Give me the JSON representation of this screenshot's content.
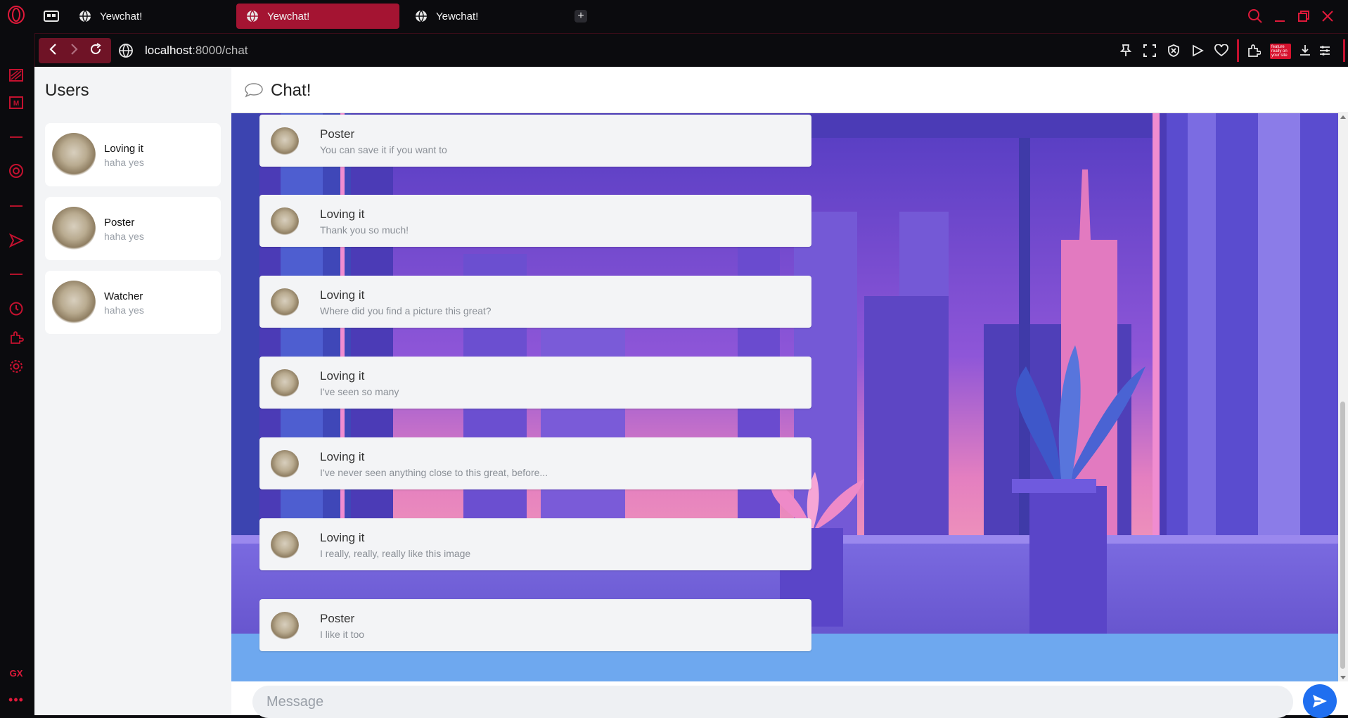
{
  "browser": {
    "tabs": [
      {
        "title": "Yewchat!",
        "active": false
      },
      {
        "title": "Yewchat!",
        "active": true
      },
      {
        "title": "Yewchat!",
        "active": false
      }
    ],
    "new_tab_label": "+",
    "url_host": "localhost",
    "url_path": ":8000/chat",
    "accent_color": "#e0193a",
    "sidebar_badge": "GX",
    "sidebar_more": "•••",
    "extension_thumb_text": "feature really on your site"
  },
  "users_panel": {
    "title": "Users",
    "users": [
      {
        "name": "Loving it",
        "status": "haha yes"
      },
      {
        "name": "Poster",
        "status": "haha yes"
      },
      {
        "name": "Watcher",
        "status": "haha yes"
      }
    ]
  },
  "chat": {
    "title": "Chat!",
    "messages": [
      {
        "author": "Poster",
        "text": "You can save it if you want to"
      },
      {
        "author": "Loving it",
        "text": "Thank you so much!"
      },
      {
        "author": "Loving it",
        "text": "Where did you find a picture this great?"
      },
      {
        "author": "Loving it",
        "text": "I've seen so many"
      },
      {
        "author": "Loving it",
        "text": "I've never seen anything close to this great, before..."
      },
      {
        "author": "Loving it",
        "text": "I really, really, really like this image"
      },
      {
        "author": "Poster",
        "text": "I like it too"
      }
    ],
    "input_placeholder": "Message",
    "send_icon": "send-icon"
  }
}
